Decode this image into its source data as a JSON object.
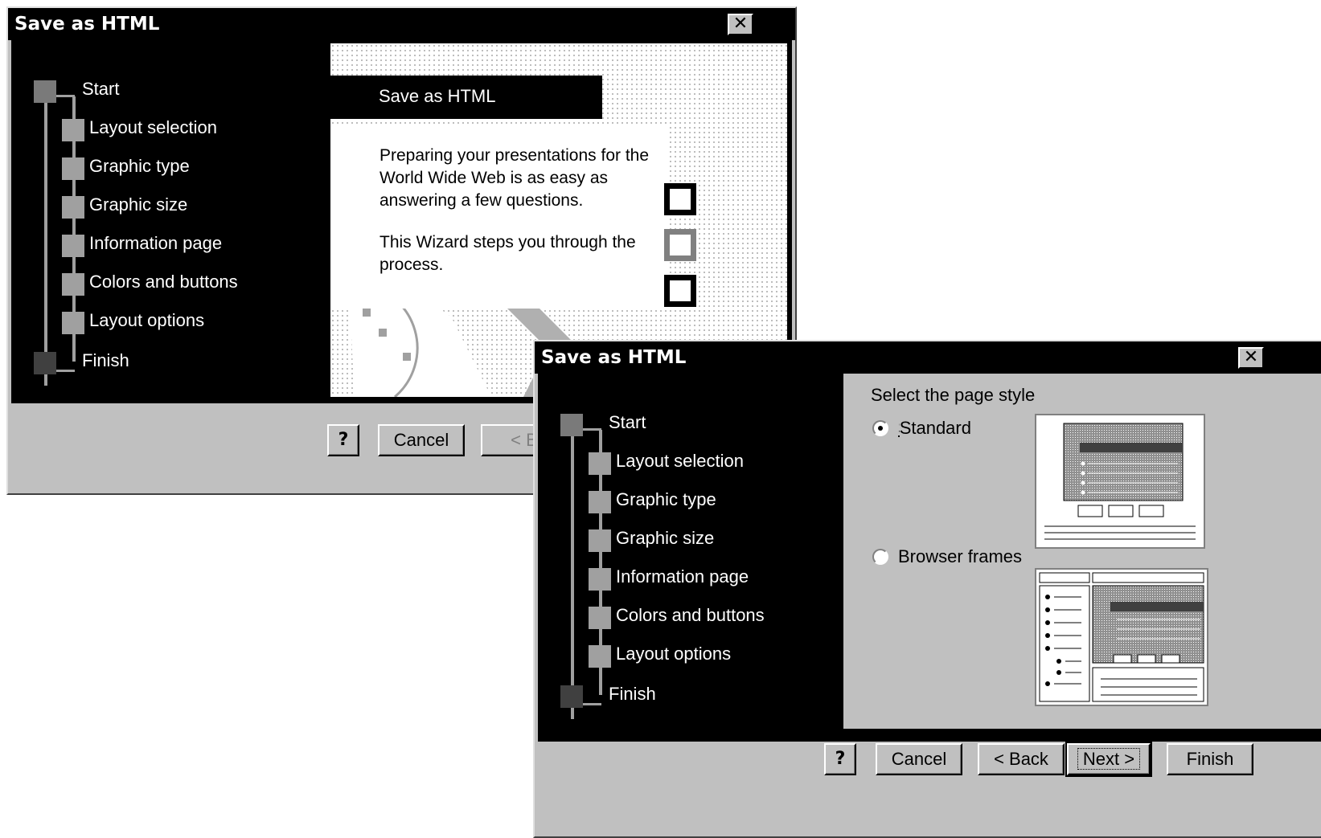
{
  "dialog_intro": {
    "title": "Save as HTML",
    "close_glyph": "✕",
    "steps": [
      "Start",
      "Layout selection",
      "Graphic type",
      "Graphic size",
      "Information page",
      "Colors and buttons",
      "Layout options",
      "Finish"
    ],
    "banner": "Save as HTML",
    "para1": "Preparing  your presentations for the World Wide Web is as easy as answering a few questions.",
    "para2": "This Wizard steps you through the process.",
    "buttons": {
      "help": "?",
      "cancel": "Cancel",
      "back": "< B"
    }
  },
  "dialog_style": {
    "title": "Save as HTML",
    "close_glyph": "✕",
    "steps": [
      "Start",
      "Layout selection",
      "Graphic type",
      "Graphic size",
      "Information page",
      "Colors and buttons",
      "Layout options",
      "Finish"
    ],
    "prompt": "Select the page style",
    "options": [
      {
        "label": "Standard",
        "selected": true
      },
      {
        "label": "Browser frames",
        "selected": false
      }
    ],
    "buttons": {
      "help": "?",
      "cancel": "Cancel",
      "back": "< Back",
      "next": "Next >",
      "finish": "Finish"
    }
  },
  "colors": {
    "face": "#c0c0c0",
    "titlebar": "#000000",
    "panel": "#000000",
    "step": "#a0a0a0"
  }
}
